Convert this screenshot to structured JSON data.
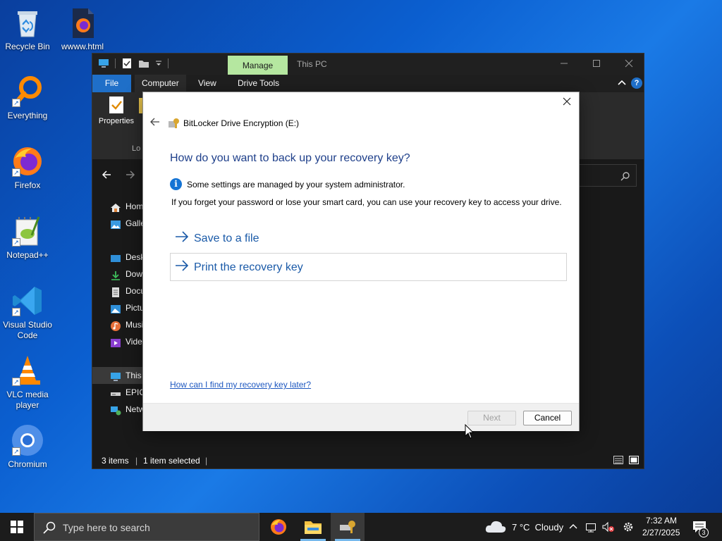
{
  "desktop": {
    "icons": [
      {
        "label": "Recycle Bin"
      },
      {
        "label": "wwww.html"
      },
      {
        "label": "Everything"
      },
      {
        "label": "Firefox"
      },
      {
        "label": "Notepad++"
      },
      {
        "label": "Visual Studio Code"
      },
      {
        "label": "VLC media player"
      },
      {
        "label": "Chromium"
      }
    ]
  },
  "explorer": {
    "title": "This PC",
    "manage_tab": "Manage",
    "ribbon_tabs": [
      "File",
      "Computer",
      "View",
      "Drive Tools"
    ],
    "ribbon_buttons": {
      "properties": "Properties",
      "location_group": "Lo"
    },
    "sidebar": [
      {
        "label": "Hom",
        "icon": "home-icon"
      },
      {
        "label": "Galle",
        "icon": "gallery-icon"
      },
      {
        "label": "Desk",
        "icon": "desktop-icon"
      },
      {
        "label": "Dow",
        "icon": "downloads-icon"
      },
      {
        "label": "Docu",
        "icon": "documents-icon"
      },
      {
        "label": "Pictu",
        "icon": "pictures-icon"
      },
      {
        "label": "Musi",
        "icon": "music-icon"
      },
      {
        "label": "Vide",
        "icon": "videos-icon"
      },
      {
        "label": "This",
        "icon": "this-pc-icon"
      },
      {
        "label": "EPIC",
        "icon": "drive-icon"
      },
      {
        "label": "Netw",
        "icon": "network-icon"
      }
    ],
    "status": {
      "items": "3 items",
      "selected": "1 item selected"
    }
  },
  "dialog": {
    "title": "BitLocker Drive Encryption (E:)",
    "heading": "How do you want to back up your recovery key?",
    "info": "Some settings are managed by your system administrator.",
    "description": "If you forget your password or lose your smart card, you can use your recovery key to access your drive.",
    "options": [
      "Save to a file",
      "Print the recovery key"
    ],
    "help_link": "How can I find my recovery key later?",
    "next_label": "Next",
    "cancel_label": "Cancel"
  },
  "taskbar": {
    "search_placeholder": "Type here to search",
    "weather": "7 °C  Cloudy",
    "time": "7:32 AM",
    "date": "2/27/2025",
    "notification_count": "3"
  },
  "colors": {
    "accent": "#1f6fc8",
    "manage_tab": "#b5e7a0",
    "dialog_heading": "#1e3f8a",
    "link": "#1e58c0"
  }
}
